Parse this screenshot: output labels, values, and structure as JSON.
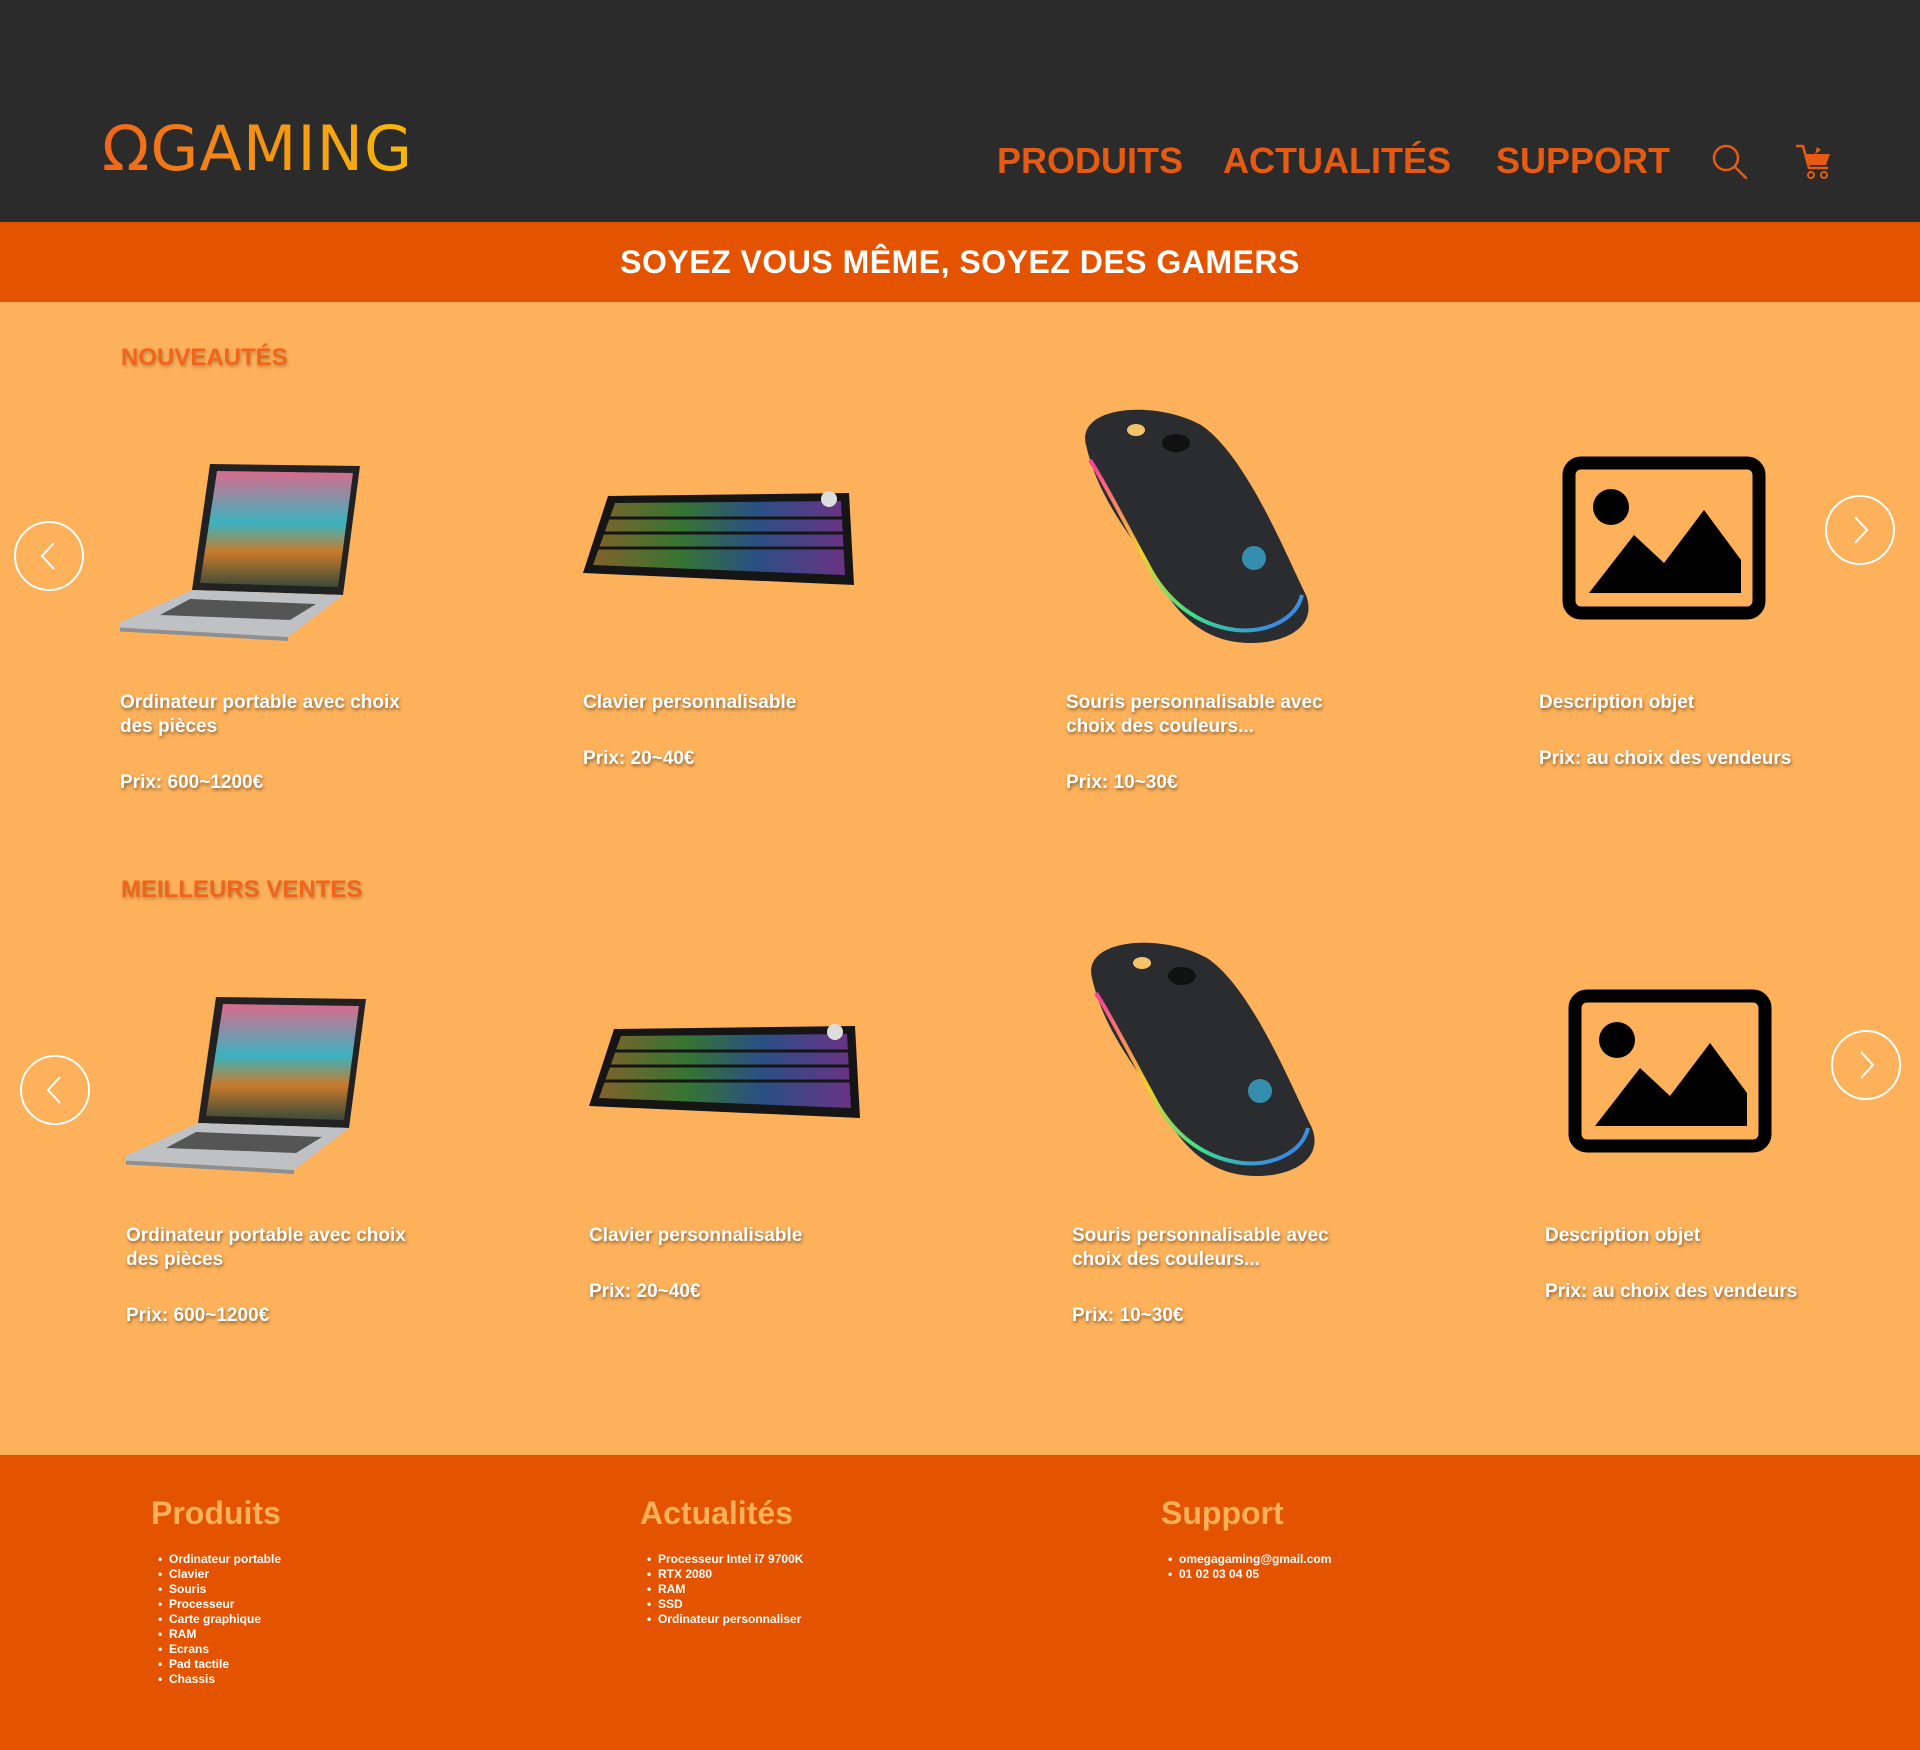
{
  "header": {
    "logo": "ΩGAMING",
    "nav": [
      "PRODUITS",
      "ACTUALITÉS",
      "SUPPORT"
    ],
    "icons": [
      "search-icon",
      "cart-icon"
    ]
  },
  "banner": "SOYEZ VOUS MÊME, SOYEZ DES GAMERS",
  "sections": [
    {
      "title": "NOUVEAUTÉS",
      "products": [
        {
          "desc": "Ordinateur portable avec choix des pièces",
          "price": "Prix: 600~1200€",
          "image": "laptop"
        },
        {
          "desc": "Clavier personnalisable",
          "price": "Prix: 20~40€",
          "image": "keyboard"
        },
        {
          "desc": "Souris personnalisable avec choix des couleurs...",
          "price": "Prix: 10~30€",
          "image": "mouse"
        },
        {
          "desc": "Description objet",
          "price": "Prix: au choix des vendeurs",
          "image": "image-placeholder-icon"
        }
      ]
    },
    {
      "title": "MEILLEURS VENTES",
      "products": [
        {
          "desc": "Ordinateur portable avec choix des pièces",
          "price": "Prix: 600~1200€",
          "image": "laptop"
        },
        {
          "desc": "Clavier personnalisable",
          "price": "Prix: 20~40€",
          "image": "keyboard"
        },
        {
          "desc": "Souris personnalisable avec choix des couleurs...",
          "price": "Prix: 10~30€",
          "image": "mouse"
        },
        {
          "desc": "Description objet",
          "price": "Prix: au choix des vendeurs",
          "image": "image-placeholder-icon"
        }
      ]
    }
  ],
  "footer": {
    "columns": [
      {
        "title": "Produits",
        "items": [
          "Ordinateur portable",
          "Clavier",
          "Souris",
          "Processeur",
          "Carte graphique",
          "RAM",
          "Ecrans",
          "Pad tactile",
          "Chassis"
        ]
      },
      {
        "title": "Actualités",
        "items": [
          "Processeur Intel i7 9700K",
          "RTX 2080",
          "RAM",
          "SSD",
          "Ordinateur personnaliser"
        ]
      },
      {
        "title": "Support",
        "items": [
          "omegagaming@gmail.com",
          "01 02 03 04 05"
        ]
      }
    ]
  },
  "colors": {
    "header_bg": "#2b2b2b",
    "accent": "#e65a12",
    "banner_bg": "#e35300",
    "page_bg": "#fdb15b",
    "footer_bg": "#e35300",
    "footer_title": "#fdb15b"
  }
}
